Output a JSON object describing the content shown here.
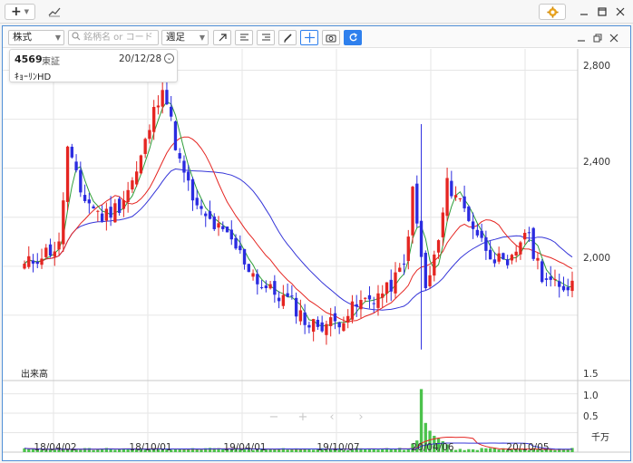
{
  "app": {
    "settings_icon": "gear-icon",
    "add_icon": "plus-icon",
    "chart_icon": "chart-line-icon"
  },
  "toolbar": {
    "market": "株式",
    "search_placeholder": "銘柄名 or コード",
    "period": "週足"
  },
  "info": {
    "code": "4569",
    "exchange": "東証",
    "date": "20/12/28",
    "name": "ｷｮｰﾘﾝHD"
  },
  "volume_pane": {
    "label": "出来高",
    "unit": "千万"
  },
  "chart_data": {
    "type": "candlestick",
    "price_ylim": [
      1600,
      2850
    ],
    "price_ticks": [
      "2,800",
      "2,400",
      "2,000"
    ],
    "volume_ylim": [
      0,
      1.7
    ],
    "volume_ticks": [
      "1.5",
      "1.0",
      "0.5"
    ],
    "x_ticks": [
      "18/04/02",
      "18/10/01",
      "19/04/01",
      "19/10/07",
      "20/04/06",
      "20/10/05"
    ],
    "colors": {
      "up": "#e52521",
      "down": "#2b2ce0",
      "ma_short": "#2e9d3a",
      "ma_mid": "#e52521",
      "ma_long": "#3535d8",
      "volume": "#4cc24c"
    },
    "anchors": [
      [
        0,
        2000
      ],
      [
        4,
        2050
      ],
      [
        8,
        2080
      ],
      [
        10,
        2480
      ],
      [
        13,
        2300
      ],
      [
        18,
        2200
      ],
      [
        22,
        2250
      ],
      [
        26,
        2380
      ],
      [
        32,
        2750
      ],
      [
        36,
        2420
      ],
      [
        40,
        2230
      ],
      [
        48,
        2100
      ],
      [
        55,
        1920
      ],
      [
        62,
        1850
      ],
      [
        66,
        1760
      ],
      [
        72,
        1770
      ],
      [
        78,
        1850
      ],
      [
        84,
        1900
      ],
      [
        88,
        2000
      ],
      [
        90,
        2300
      ],
      [
        93,
        1900
      ],
      [
        96,
        2100
      ],
      [
        98,
        2330
      ],
      [
        100,
        2300
      ],
      [
        106,
        2100
      ],
      [
        112,
        1980
      ],
      [
        116,
        2150
      ],
      [
        120,
        1970
      ],
      [
        124,
        1900
      ],
      [
        127,
        1940
      ]
    ],
    "volume_spike": {
      "week": 92,
      "value": 1.62
    }
  }
}
